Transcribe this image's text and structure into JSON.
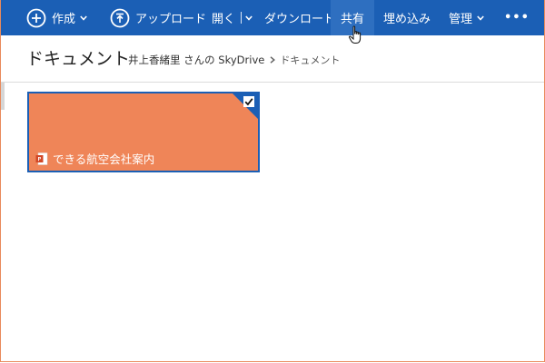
{
  "commandbar": {
    "create_label": "作成",
    "upload_label": "アップロード",
    "open_label": "開く",
    "download_label": "ダウンロード",
    "share_label": "共有",
    "embed_label": "埋め込み",
    "manage_label": "管理",
    "more_label": "•••"
  },
  "header": {
    "title": "ドキュメント",
    "breadcrumb": {
      "owner": "井上香緒里 さんの SkyDrive",
      "current": "ドキュメント"
    }
  },
  "files": [
    {
      "name": "できる航空会社案内",
      "type": "powerpoint",
      "selected": true,
      "tile_color": "#ef8558"
    }
  ],
  "colors": {
    "accent": "#1b5fb5",
    "tile": "#ef8558"
  },
  "icons": {
    "create": "plus-circle-icon",
    "upload": "upload-circle-icon",
    "file": "powerpoint-file-icon",
    "cursor": "hand-cursor-icon"
  }
}
